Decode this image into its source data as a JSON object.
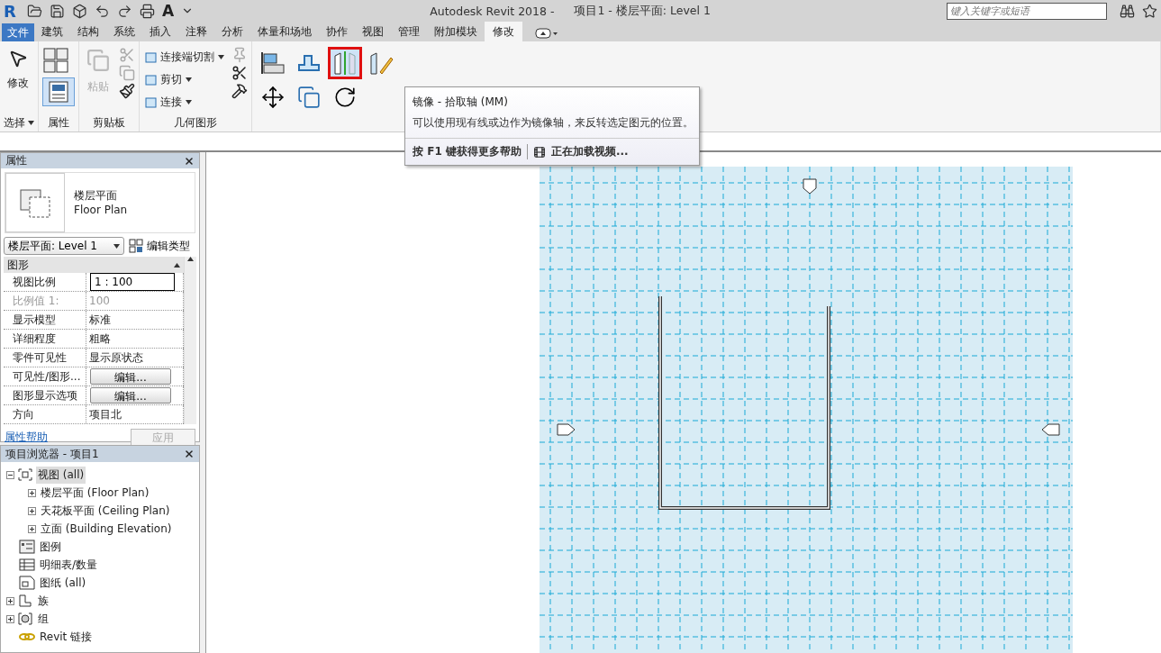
{
  "title_bar": {
    "logo": "R",
    "text_tool": "A",
    "app_title": "Autodesk Revit 2018 -",
    "document": "项目1 - 楼层平面: Level 1",
    "search_placeholder": "键入关键字或短语"
  },
  "file_tab": "文件",
  "tabs": [
    {
      "label": "建筑",
      "selected": false
    },
    {
      "label": "结构",
      "selected": false
    },
    {
      "label": "系统",
      "selected": false
    },
    {
      "label": "插入",
      "selected": false
    },
    {
      "label": "注释",
      "selected": false
    },
    {
      "label": "分析",
      "selected": false
    },
    {
      "label": "体量和场地",
      "selected": false
    },
    {
      "label": "协作",
      "selected": false
    },
    {
      "label": "视图",
      "selected": false
    },
    {
      "label": "管理",
      "selected": false
    },
    {
      "label": "附加模块",
      "selected": false
    },
    {
      "label": "修改",
      "selected": true
    }
  ],
  "ribbon": {
    "select": {
      "button": "修改",
      "title": "选择"
    },
    "properties": {
      "title": "属性"
    },
    "clipboard": {
      "paste": "粘贴",
      "paste_disabled": true,
      "title": "剪贴板"
    },
    "geometry": {
      "commands": [
        "连接端切割",
        "剪切",
        "连接"
      ],
      "title": "几何图形"
    },
    "modify_tools": [
      {
        "kind": "align",
        "highlighted": false
      },
      {
        "kind": "offset",
        "highlighted": false
      },
      {
        "kind": "mirror-axis",
        "highlighted": true
      },
      {
        "kind": "mirror-draw",
        "highlighted": false
      },
      {
        "kind": "move",
        "highlighted": false
      },
      {
        "kind": "copy",
        "highlighted": false
      },
      {
        "kind": "rotate",
        "highlighted": false
      }
    ]
  },
  "tooltip": {
    "title": "镜像 - 拾取轴 (MM)",
    "description": "可以使用现有线或边作为镜像轴，来反转选定图元的位置。",
    "help": "按 **F1** 键获得更多帮助",
    "video": "正在加载视频..."
  },
  "properties": {
    "title": "属性",
    "type_name": "楼层平面",
    "type_name_en": "Floor Plan",
    "selector": "楼层平面: Level 1",
    "edit_type": "编辑类型",
    "group": "图形",
    "rows": [
      {
        "label": "视图比例",
        "value": "1 : 100",
        "kind": "input",
        "disabled": false
      },
      {
        "label": "比例值 1:",
        "value": "100",
        "kind": "text",
        "disabled": true
      },
      {
        "label": "显示模型",
        "value": "标准",
        "kind": "text",
        "disabled": false
      },
      {
        "label": "详细程度",
        "value": "粗略",
        "kind": "text",
        "disabled": false
      },
      {
        "label": "零件可见性",
        "value": "显示原状态",
        "kind": "text",
        "disabled": false
      },
      {
        "label": "可见性/图形...",
        "value": "编辑...",
        "kind": "button",
        "disabled": false
      },
      {
        "label": "图形显示选项",
        "value": "编辑...",
        "kind": "button",
        "disabled": false
      },
      {
        "label": "方向",
        "value": "项目北",
        "kind": "text",
        "disabled": false
      }
    ],
    "help_link": "属性帮助",
    "apply": "应用",
    "apply_disabled": true
  },
  "browser": {
    "title": "项目浏览器 - 项目1",
    "tree": [
      {
        "label": "视图 (all)",
        "kind": "views",
        "expanded": true,
        "selected": true,
        "children": [
          {
            "label": "楼层平面 (Floor Plan)",
            "expanded": false,
            "selected": false
          },
          {
            "label": "天花板平面 (Ceiling Plan)",
            "expanded": false,
            "selected": false
          },
          {
            "label": "立面 (Building Elevation)",
            "expanded": false,
            "selected": false
          }
        ]
      },
      {
        "label": "图例",
        "kind": "legend",
        "selected": false
      },
      {
        "label": "明细表/数量",
        "kind": "schedule",
        "selected": false
      },
      {
        "label": "图纸 (all)",
        "kind": "sheet",
        "selected": false
      },
      {
        "label": "族",
        "kind": "family",
        "expanded": false,
        "selected": false
      },
      {
        "label": "组",
        "kind": "group",
        "expanded": false,
        "selected": false
      },
      {
        "label": "Revit 链接",
        "kind": "link",
        "selected": false
      }
    ]
  }
}
